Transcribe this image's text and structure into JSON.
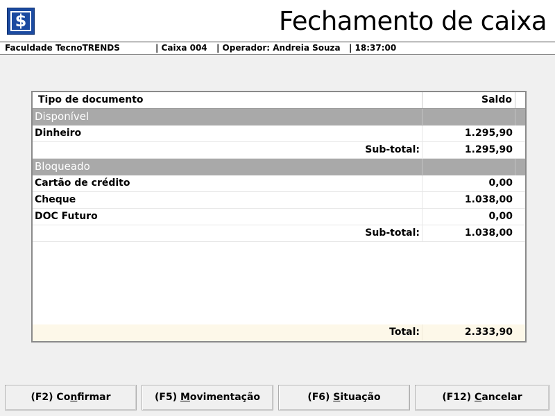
{
  "header": {
    "logo_glyph": "$",
    "title": "Fechamento de caixa"
  },
  "status": {
    "institution": "Faculdade TecnoTRENDS",
    "register": "| Caixa 004",
    "operator": "| Operador: Andreia Souza",
    "time": "| 18:37:00"
  },
  "grid": {
    "col_type": "Tipo de documento",
    "col_balance": "Saldo",
    "rows": [
      {
        "kind": "group",
        "label": "Disponível"
      },
      {
        "kind": "item",
        "label": "Dinheiro",
        "value": "1.295,90"
      },
      {
        "kind": "subtotal",
        "label": "Sub-total:",
        "value": "1.295,90"
      },
      {
        "kind": "group",
        "label": "Bloqueado"
      },
      {
        "kind": "item",
        "label": "Cartão de crédito",
        "value": "0,00"
      },
      {
        "kind": "item",
        "label": "Cheque",
        "value": "1.038,00"
      },
      {
        "kind": "item",
        "label": "DOC Futuro",
        "value": "0,00"
      },
      {
        "kind": "subtotal",
        "label": "Sub-total:",
        "value": "1.038,00"
      }
    ],
    "total_label": "Total:",
    "total_value": "2.333,90"
  },
  "buttons": {
    "confirm": {
      "prefix": "(F2) Co",
      "mnemonic": "n",
      "suffix": "firmar"
    },
    "movement": {
      "prefix": "(F5) ",
      "mnemonic": "M",
      "suffix": "ovimentação"
    },
    "situation": {
      "prefix": "(F6) ",
      "mnemonic": "S",
      "suffix": "ituação"
    },
    "cancel": {
      "prefix": "(F12) ",
      "mnemonic": "C",
      "suffix": "ancelar"
    }
  },
  "colors": {
    "logo_blue": "#1b4aa0",
    "group_gray": "#a9a9a9",
    "total_bg": "#fdf8e9"
  }
}
